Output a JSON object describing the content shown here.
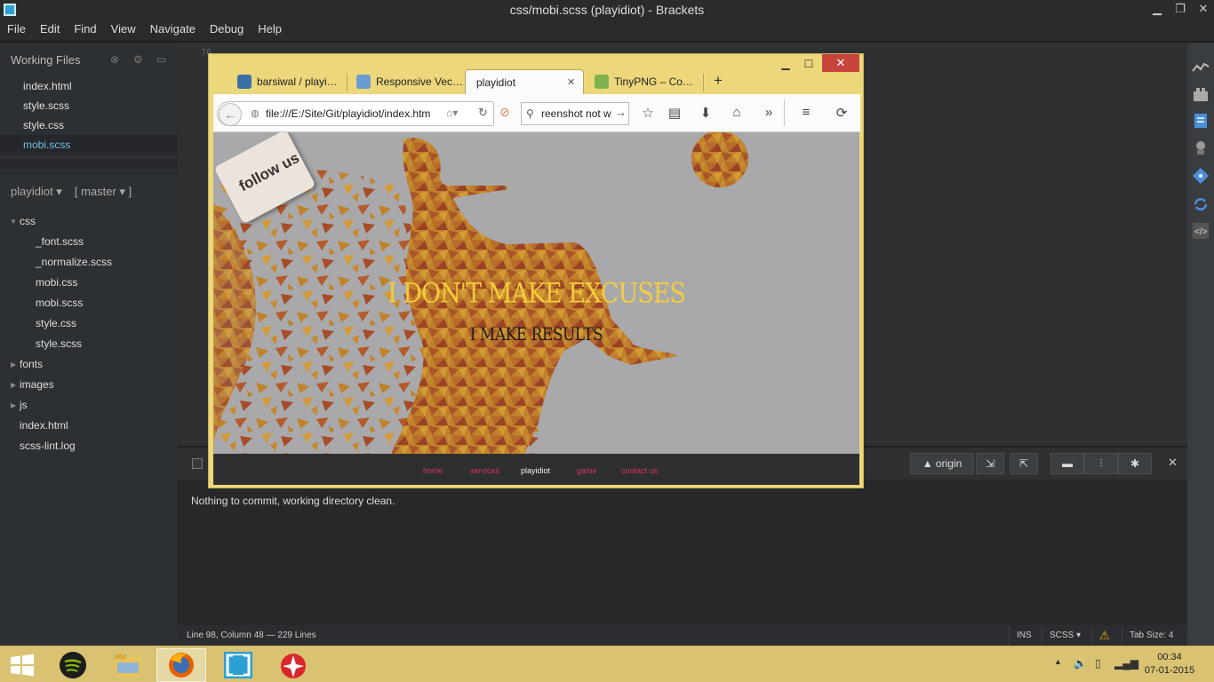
{
  "window": {
    "title": "css/mobi.scss (playidiot) - Brackets"
  },
  "menu": [
    "File",
    "Edit",
    "Find",
    "View",
    "Navigate",
    "Debug",
    "Help"
  ],
  "sidebar": {
    "working_files_label": "Working Files",
    "working_files": [
      "index.html",
      "style.scss",
      "style.css",
      "mobi.scss"
    ],
    "active_file": "mobi.scss",
    "project": "playidiot ▾",
    "branch": "[ master ▾ ]",
    "tree": [
      {
        "label": "css",
        "depth": 0,
        "expanded": true
      },
      {
        "label": "_font.scss",
        "depth": 1
      },
      {
        "label": "_normalize.scss",
        "depth": 1
      },
      {
        "label": "mobi.css",
        "depth": 1
      },
      {
        "label": "mobi.scss",
        "depth": 1
      },
      {
        "label": "style.css",
        "depth": 1
      },
      {
        "label": "style.scss",
        "depth": 1
      },
      {
        "label": "fonts",
        "depth": 0,
        "expanded": false
      },
      {
        "label": "images",
        "depth": 0,
        "expanded": false
      },
      {
        "label": "js",
        "depth": 0,
        "expanded": false
      },
      {
        "label": "index.html",
        "depth": 0
      },
      {
        "label": "scss-lint.log",
        "depth": 0
      }
    ]
  },
  "editor": {
    "line_number_top": "76"
  },
  "git": {
    "origin_label": "▲ origin",
    "message": "Nothing to commit, working directory clean."
  },
  "status": {
    "position": "Line 98, Column 48",
    "lines": "— 229 Lines",
    "mode": "INS",
    "language": "SCSS",
    "tab_size": "Tab Size:  4"
  },
  "firefox": {
    "tabs": [
      {
        "label": "barsiwal / playi…",
        "fav_color": "#3b6ea5"
      },
      {
        "label": "Responsive Vec…",
        "fav_color": "#6c9bd2"
      },
      {
        "label": "playidiot",
        "fav_color": "",
        "active": true
      },
      {
        "label": "TinyPNG – Co…",
        "fav_color": "#7fb24c"
      }
    ],
    "url": "file:///E:/Site/Git/playidiot/index.htm",
    "search": "reenshot not w"
  },
  "page": {
    "follow": "follow us",
    "headline": "I DON'T MAKE EXCUSES",
    "subline": "I MAKE RESULTS",
    "nav": [
      "home",
      "services",
      "playidiot",
      "game",
      "contact us"
    ],
    "nav_current": "playidiot"
  },
  "taskbar": {
    "apps": [
      "start",
      "spotify",
      "file-explorer",
      "firefox",
      "brackets",
      "other-app"
    ],
    "time": "00:34",
    "date": "07-01-2015"
  },
  "colors": {
    "accent": "#6dbde8",
    "page_bg": "#a9a9ab",
    "headline": "#f3cd3c",
    "nav_link": "#d6355a",
    "firefox_frame": "#ecd77b"
  }
}
